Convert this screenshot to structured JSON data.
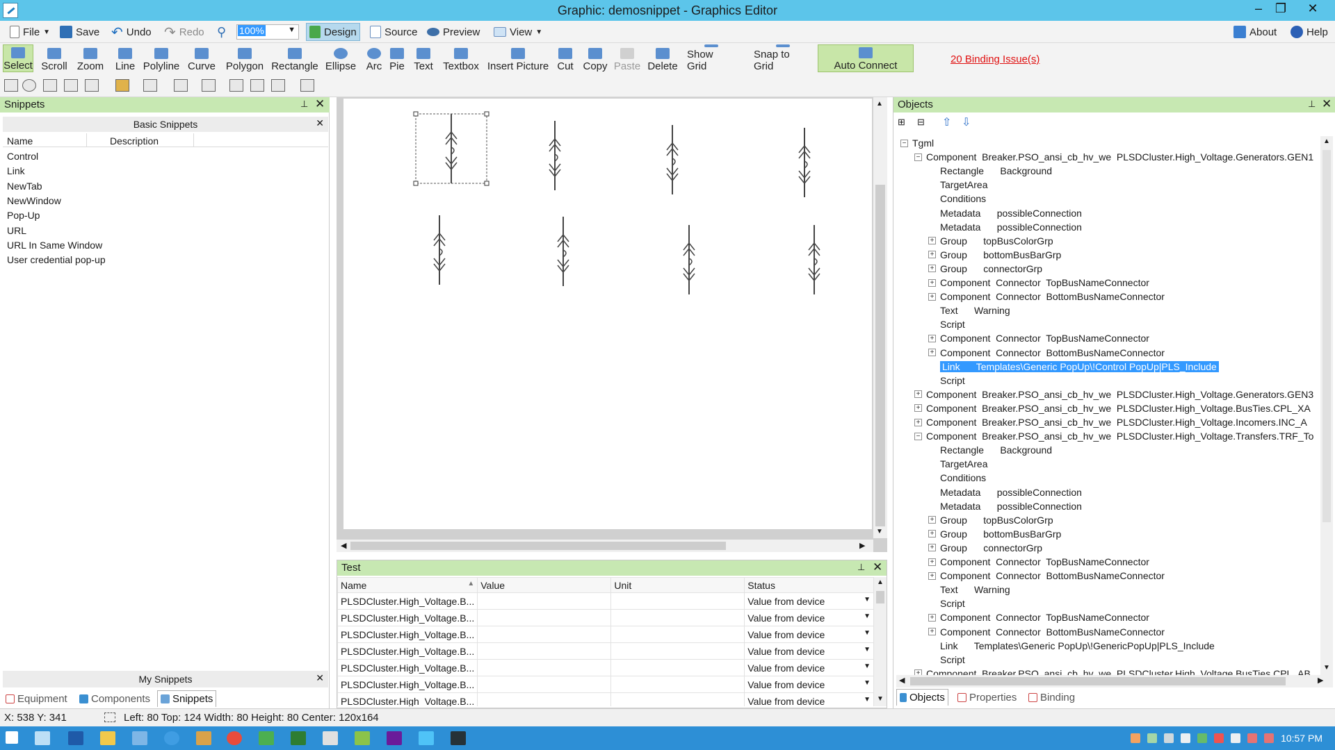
{
  "window": {
    "title": "Graphic: demosnippet - Graphics Editor",
    "minimize": "–",
    "maximize": "❐",
    "close": "✕"
  },
  "menubar": {
    "file": "File",
    "save": "Save",
    "undo": "Undo",
    "redo": "Redo",
    "zoom": "100%",
    "design": "Design",
    "source": "Source",
    "preview": "Preview",
    "view": "View",
    "about": "About",
    "help": "Help"
  },
  "tools": [
    {
      "label": "Select",
      "icon": "select-arrow-icon"
    },
    {
      "label": "Scroll",
      "icon": "hand-icon"
    },
    {
      "label": "Zoom",
      "icon": "magnifier-icon"
    },
    {
      "label": "Line",
      "icon": "line-icon"
    },
    {
      "label": "Polyline",
      "icon": "polyline-icon"
    },
    {
      "label": "Curve",
      "icon": "curve-icon"
    },
    {
      "label": "Polygon",
      "icon": "polygon-icon"
    },
    {
      "label": "Rectangle",
      "icon": "rectangle-icon"
    },
    {
      "label": "Ellipse",
      "icon": "ellipse-icon"
    },
    {
      "label": "Arc",
      "icon": "arc-icon"
    },
    {
      "label": "Pie",
      "icon": "pie-icon"
    },
    {
      "label": "Text",
      "icon": "text-icon"
    },
    {
      "label": "Textbox",
      "icon": "textbox-icon"
    },
    {
      "label": "Insert Picture",
      "icon": "picture-icon"
    },
    {
      "label": "Cut",
      "icon": "scissors-icon"
    },
    {
      "label": "Copy",
      "icon": "copy-icon"
    },
    {
      "label": "Paste",
      "icon": "paste-icon"
    },
    {
      "label": "Delete",
      "icon": "delete-icon"
    },
    {
      "label": "Show Grid",
      "icon": "grid-icon"
    },
    {
      "label": "Snap to Grid",
      "icon": "snap-icon"
    },
    {
      "label": "Auto Connect",
      "icon": "connect-icon"
    }
  ],
  "binding_issues": "20 Binding Issue(s)",
  "snippets": {
    "title": "Snippets",
    "group": "Basic Snippets",
    "col_name": "Name",
    "col_desc": "Description",
    "items": [
      "Control",
      "Link",
      "NewTab",
      "NewWindow",
      "Pop-Up",
      "URL",
      "URL In Same Window",
      "User credential pop-up"
    ],
    "my_snippets": "My Snippets",
    "tabs": [
      "Equipment",
      "Components",
      "Snippets"
    ]
  },
  "test": {
    "title": "Test",
    "headers": [
      "Name",
      "Value",
      "Unit",
      "Status"
    ],
    "rows": [
      {
        "name": "PLSDCluster.High_Voltage.B...",
        "status": "Value from device"
      },
      {
        "name": "PLSDCluster.High_Voltage.B...",
        "status": "Value from device"
      },
      {
        "name": "PLSDCluster.High_Voltage.B...",
        "status": "Value from device"
      },
      {
        "name": "PLSDCluster.High_Voltage.B...",
        "status": "Value from device"
      },
      {
        "name": "PLSDCluster.High_Voltage.B...",
        "status": "Value from device"
      },
      {
        "name": "PLSDCluster.High_Voltage.B...",
        "status": "Value from device"
      },
      {
        "name": "PLSDCluster.High_Voltage.B...",
        "status": "Value from device"
      }
    ]
  },
  "objects": {
    "title": "Objects",
    "tabs": [
      "Objects",
      "Properties",
      "Binding"
    ],
    "tree": [
      {
        "level": 0,
        "exp": "−",
        "text": "Tgml"
      },
      {
        "level": 1,
        "exp": "−",
        "text": "Component  Breaker.PSO_ansi_cb_hv_we  PLSDCluster.High_Voltage.Generators.GEN1"
      },
      {
        "level": 2,
        "exp": "",
        "text": "Rectangle      Background"
      },
      {
        "level": 2,
        "exp": "",
        "text": "TargetArea"
      },
      {
        "level": 2,
        "exp": "",
        "text": "Conditions"
      },
      {
        "level": 2,
        "exp": "",
        "text": "Metadata      possibleConnection"
      },
      {
        "level": 2,
        "exp": "",
        "text": "Metadata      possibleConnection"
      },
      {
        "level": 2,
        "exp": "+",
        "text": "Group      topBusColorGrp"
      },
      {
        "level": 2,
        "exp": "+",
        "text": "Group      bottomBusBarGrp"
      },
      {
        "level": 2,
        "exp": "+",
        "text": "Group      connectorGrp"
      },
      {
        "level": 2,
        "exp": "+",
        "text": "Component  Connector  TopBusNameConnector"
      },
      {
        "level": 2,
        "exp": "+",
        "text": "Component  Connector  BottomBusNameConnector"
      },
      {
        "level": 2,
        "exp": "",
        "text": "Text      Warning"
      },
      {
        "level": 2,
        "exp": "",
        "text": "Script"
      },
      {
        "level": 2,
        "exp": "+",
        "text": "Component  Connector  TopBusNameConnector"
      },
      {
        "level": 2,
        "exp": "+",
        "text": "Component  Connector  BottomBusNameConnector"
      },
      {
        "level": 2,
        "exp": "",
        "text": "Link      Templates\\Generic PopUp\\!Control PopUp|PLS_Include",
        "selected": true
      },
      {
        "level": 2,
        "exp": "",
        "text": "Script"
      },
      {
        "level": 1,
        "exp": "+",
        "text": "Component  Breaker.PSO_ansi_cb_hv_we  PLSDCluster.High_Voltage.Generators.GEN3"
      },
      {
        "level": 1,
        "exp": "+",
        "text": "Component  Breaker.PSO_ansi_cb_hv_we  PLSDCluster.High_Voltage.BusTies.CPL_XA"
      },
      {
        "level": 1,
        "exp": "+",
        "text": "Component  Breaker.PSO_ansi_cb_hv_we  PLSDCluster.High_Voltage.Incomers.INC_A"
      },
      {
        "level": 1,
        "exp": "−",
        "text": "Component  Breaker.PSO_ansi_cb_hv_we  PLSDCluster.High_Voltage.Transfers.TRF_To"
      },
      {
        "level": 2,
        "exp": "",
        "text": "Rectangle      Background"
      },
      {
        "level": 2,
        "exp": "",
        "text": "TargetArea"
      },
      {
        "level": 2,
        "exp": "",
        "text": "Conditions"
      },
      {
        "level": 2,
        "exp": "",
        "text": "Metadata      possibleConnection"
      },
      {
        "level": 2,
        "exp": "",
        "text": "Metadata      possibleConnection"
      },
      {
        "level": 2,
        "exp": "+",
        "text": "Group      topBusColorGrp"
      },
      {
        "level": 2,
        "exp": "+",
        "text": "Group      bottomBusBarGrp"
      },
      {
        "level": 2,
        "exp": "+",
        "text": "Group      connectorGrp"
      },
      {
        "level": 2,
        "exp": "+",
        "text": "Component  Connector  TopBusNameConnector"
      },
      {
        "level": 2,
        "exp": "+",
        "text": "Component  Connector  BottomBusNameConnector"
      },
      {
        "level": 2,
        "exp": "",
        "text": "Text      Warning"
      },
      {
        "level": 2,
        "exp": "",
        "text": "Script"
      },
      {
        "level": 2,
        "exp": "+",
        "text": "Component  Connector  TopBusNameConnector"
      },
      {
        "level": 2,
        "exp": "+",
        "text": "Component  Connector  BottomBusNameConnector"
      },
      {
        "level": 2,
        "exp": "",
        "text": "Link      Templates\\Generic PopUp\\!GenericPopUp|PLS_Include"
      },
      {
        "level": 2,
        "exp": "",
        "text": "Script"
      },
      {
        "level": 1,
        "exp": "+",
        "text": "Component  Breaker.PSO_ansi_cb_hv_we  PLSDCluster.High_Voltage.BusTies.CPL_AB"
      }
    ]
  },
  "status": {
    "coords": "X: 538  Y: 341",
    "selection": "Left: 80  Top: 124  Width: 80  Height: 80  Center: 120x164"
  },
  "taskbar": {
    "clock": "10:57 PM"
  },
  "colors": {
    "titlebar": "#5cc5ea",
    "panel_header": "#c7e8b2",
    "selection": "#3399ff",
    "issues": "#e01010",
    "taskbar": "#2d8fd6"
  }
}
